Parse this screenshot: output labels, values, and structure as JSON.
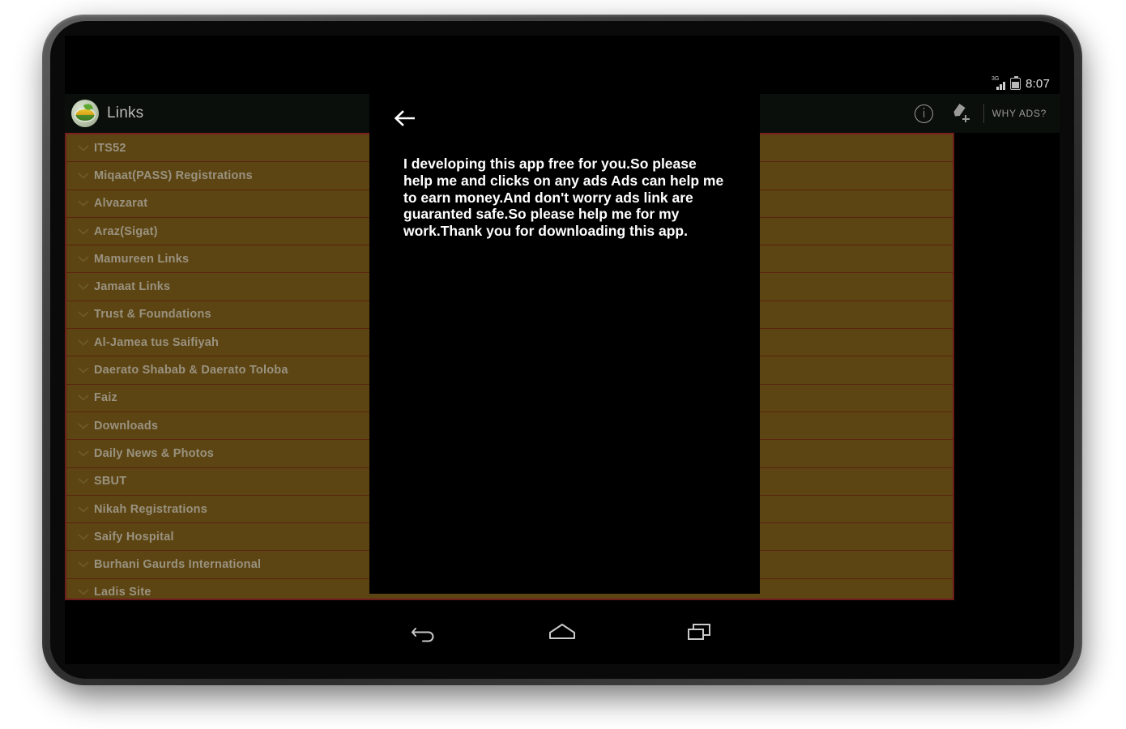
{
  "device": {
    "type": "android-tablet",
    "bezel_color": "#3c3c3c"
  },
  "status_bar": {
    "network_label": "3G",
    "signal_icon": "signal-bars-icon",
    "battery_icon": "battery-icon",
    "time": "8:07"
  },
  "action_bar": {
    "logo_icon": "app-logo-icon",
    "title": "Links",
    "actions": [
      {
        "name": "info-icon",
        "label": ""
      },
      {
        "name": "edit-add-icon",
        "label": ""
      }
    ],
    "why_ads_label": "WHY ADS?"
  },
  "list": {
    "background_color": "#5c4512",
    "border_color": "#6e1d1d",
    "divider_color": "#5a2410",
    "text_color": "#9a9280",
    "chevron_icon": "chevron-down-icon",
    "items": [
      {
        "label": "ITS52"
      },
      {
        "label": "Miqaat(PASS) Registrations"
      },
      {
        "label": "Alvazarat"
      },
      {
        "label": "Araz(Sigat)"
      },
      {
        "label": "Mamureen Links"
      },
      {
        "label": "Jamaat Links"
      },
      {
        "label": "Trust & Foundations"
      },
      {
        "label": "Al-Jamea tus Saifiyah"
      },
      {
        "label": "Daerato Shabab & Daerato Toloba"
      },
      {
        "label": "Faiz"
      },
      {
        "label": "Downloads"
      },
      {
        "label": "Daily News & Photos"
      },
      {
        "label": "SBUT"
      },
      {
        "label": "Nikah Registrations"
      },
      {
        "label": "Saify Hospital"
      },
      {
        "label": "Burhani Gaurds International"
      },
      {
        "label": "Ladis Site"
      }
    ]
  },
  "ad_overlay": {
    "back_icon": "back-arrow-icon",
    "body_text": "I developing this app free for you.So please help me and clicks on any ads Ads can help me to earn money.And don't worry ads link are guaranted safe.So please help me for my work.Thank you for downloading this app.",
    "background_color": "#000000",
    "text_color": "#ffffff"
  },
  "nav_bar": {
    "buttons": [
      {
        "name": "back-nav-icon"
      },
      {
        "name": "home-nav-icon"
      },
      {
        "name": "recents-nav-icon"
      }
    ]
  }
}
